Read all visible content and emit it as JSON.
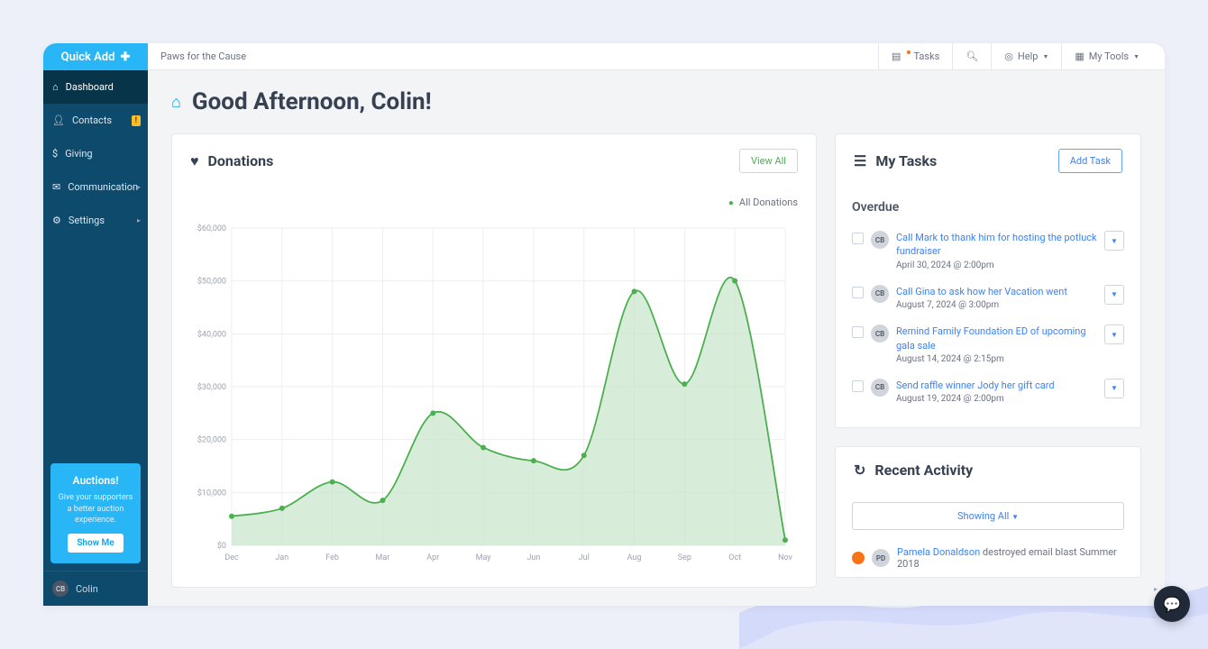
{
  "quick_add": "Quick Add",
  "org_name": "Paws for the Cause",
  "topbar": {
    "tasks": "Tasks",
    "help": "Help",
    "my_tools": "My Tools"
  },
  "sidebar": {
    "items": [
      {
        "label": "Dashboard"
      },
      {
        "label": "Contacts",
        "badge": "!"
      },
      {
        "label": "Giving"
      },
      {
        "label": "Communication",
        "chev": true
      },
      {
        "label": "Settings",
        "chev": true
      }
    ],
    "promo": {
      "title": "Auctions!",
      "text": "Give your supporters a better auction experience.",
      "cta": "Show Me"
    },
    "user": {
      "initials": "CB",
      "name": "Colin"
    }
  },
  "greeting": "Good Afternoon, Colin!",
  "donations": {
    "title": "Donations",
    "view_all": "View All",
    "legend": "All Donations"
  },
  "tasks": {
    "title": "My Tasks",
    "add": "Add Task",
    "section": "Overdue",
    "items": [
      {
        "initials": "CB",
        "text": "Call Mark to thank him for hosting the potluck fundraiser",
        "date": "April 30, 2024 @ 2:00pm"
      },
      {
        "initials": "CB",
        "text": "Call Gina to ask how her Vacation went",
        "date": "August 7, 2024 @ 3:00pm"
      },
      {
        "initials": "CB",
        "text": "Remind Family Foundation ED of upcoming gala sale",
        "date": "August 14, 2024 @ 2:15pm"
      },
      {
        "initials": "CB",
        "text": "Send raffle winner Jody her gift card",
        "date": "August 19, 2024 @ 2:00pm"
      }
    ]
  },
  "activity": {
    "title": "Recent Activity",
    "filter": "Showing All",
    "row": {
      "initials": "PD",
      "actor": "Pamela Donaldson",
      "rest": " destroyed email blast Summer 2018"
    }
  },
  "chart_data": {
    "type": "area",
    "title": "Donations",
    "legend": [
      "All Donations"
    ],
    "xlabel": "",
    "ylabel": "",
    "ylim": [
      0,
      60000
    ],
    "yticks": [
      0,
      10000,
      20000,
      30000,
      40000,
      50000,
      60000
    ],
    "ytick_labels": [
      "$0",
      "$10,000",
      "$20,000",
      "$30,000",
      "$40,000",
      "$50,000",
      "$60,000"
    ],
    "categories": [
      "Dec",
      "Jan",
      "Feb",
      "Mar",
      "Apr",
      "May",
      "Jun",
      "Jul",
      "Aug",
      "Sep",
      "Oct",
      "Nov"
    ],
    "series": [
      {
        "name": "All Donations",
        "values": [
          5500,
          7000,
          12000,
          8500,
          25000,
          18500,
          16000,
          17000,
          48000,
          30500,
          50000,
          1000
        ]
      }
    ]
  }
}
